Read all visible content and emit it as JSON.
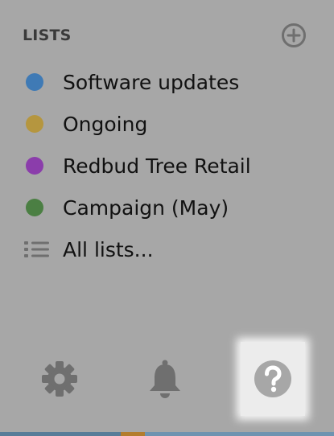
{
  "header": {
    "title": "LISTS",
    "add_icon": "plus-circle-icon"
  },
  "lists": [
    {
      "label": "Software updates",
      "color": "#3f7ab5"
    },
    {
      "label": "Ongoing",
      "color": "#b5963f"
    },
    {
      "label": "Redbud Tree Retail",
      "color": "#8b3dab"
    },
    {
      "label": "Campaign (May)",
      "color": "#4b7f43"
    }
  ],
  "all_lists": {
    "label": "All lists...",
    "icon": "list-icon"
  },
  "footer": {
    "settings_icon": "gear-icon",
    "notifications_icon": "bell-icon",
    "help_icon": "question-icon",
    "active": "help"
  },
  "colors": {
    "panel_bg": "#a7a7a7",
    "icon_gray": "#6f6f6f",
    "active_bg": "#ececec"
  }
}
